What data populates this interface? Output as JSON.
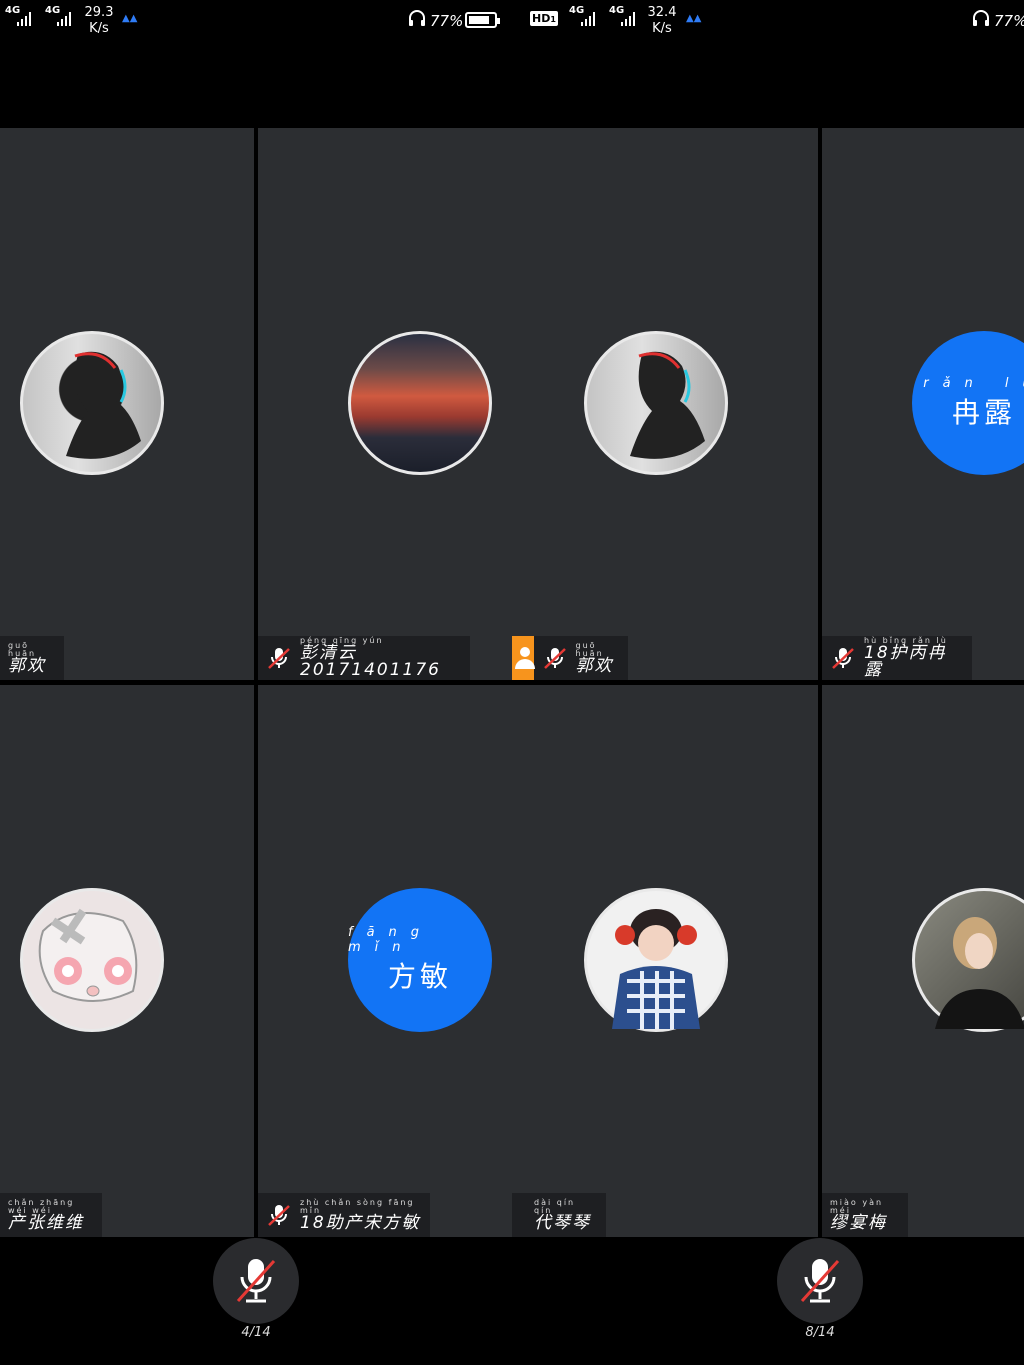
{
  "status_left": {
    "net1": "4G",
    "net2": "4G",
    "speed_value": "29.3",
    "speed_unit": "K/s",
    "battery_percent": "77%"
  },
  "status_right": {
    "hd": "HD",
    "hd_sub": "1",
    "net1": "4G",
    "net2": "4G",
    "speed_value": "32.4",
    "speed_unit": "K/s",
    "battery_percent": "77%"
  },
  "tiles": [
    {
      "avatar": "avatar-glitch-silhouette",
      "name_pinyin": "guō huān",
      "name": "郭欢"
    },
    {
      "avatar": "avatar-sunset-clouds",
      "name_pinyin": "péng qīng yún",
      "name": "彭清云20171401176"
    },
    {
      "avatar": "avatar-glitch-silhouette",
      "name_pinyin": "guō huān",
      "name": "郭欢"
    },
    {
      "avatar_pinyin": "rǎn lù",
      "avatar_text": "冉露",
      "name_pinyin": "hù bǐng rǎn lù",
      "name": "18护丙冉露"
    },
    {
      "avatar": "avatar-anime-girl",
      "name_pinyin": "chǎn zhāng wéi wéi",
      "name": "产张维维"
    },
    {
      "avatar_pinyin": "fāng mǐn",
      "avatar_text": "方敏",
      "name_pinyin": "zhù chǎn sòng fāng mǐn",
      "name": "18助产宋方敏"
    },
    {
      "avatar": "avatar-girl-tomatoes",
      "name_pinyin": "dài qín qín",
      "name": "代琴琴"
    },
    {
      "avatar": "avatar-blonde-portrait",
      "name_pinyin": "miào yàn méi",
      "name": "缪宴梅"
    }
  ],
  "pager": {
    "left": "4/14",
    "right": "8/14"
  },
  "colors": {
    "tile_bg": "#2c2e31",
    "accent_blue": "#1274f5",
    "muted_red": "#e53935",
    "orange": "#f7941d"
  }
}
